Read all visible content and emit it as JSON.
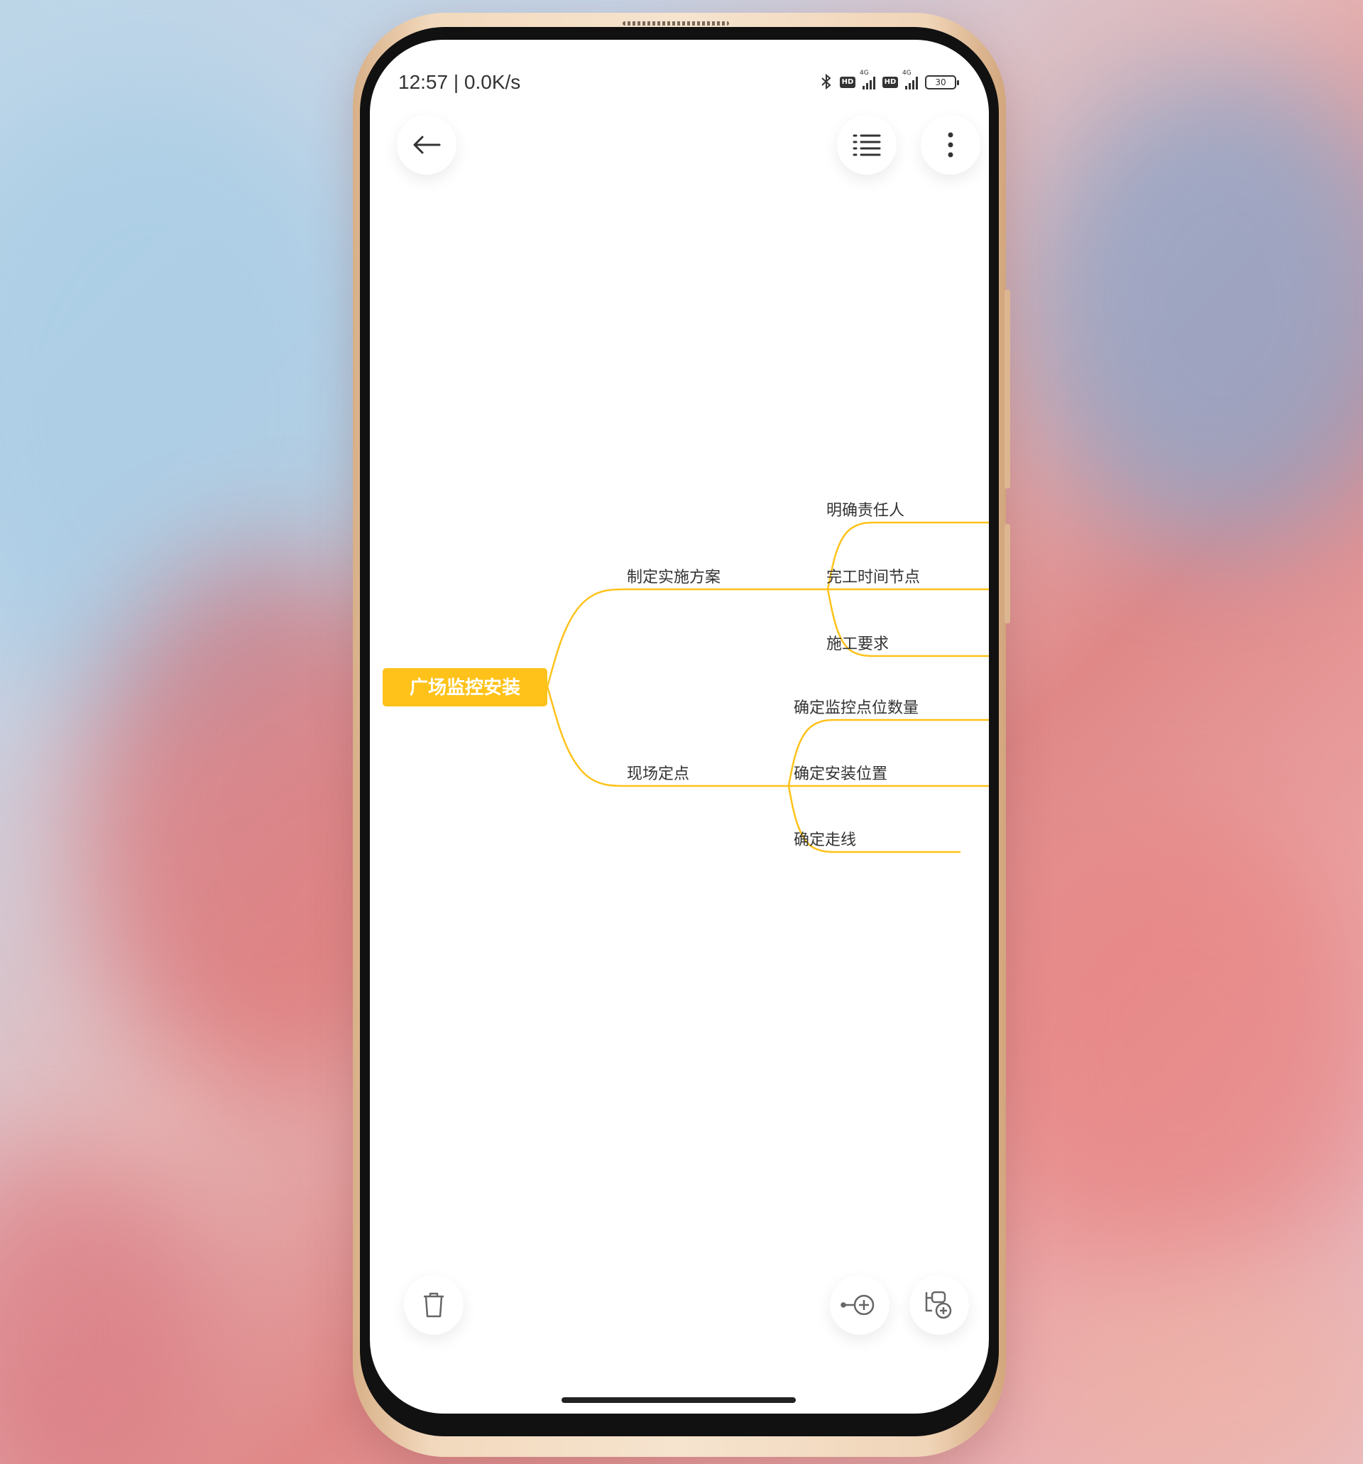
{
  "status_bar": {
    "time_speed": "12:57 | 0.0K/s",
    "bluetooth_icon": "bluetooth-icon",
    "hd_label": "HD",
    "network_label": "4G",
    "battery_level": "30"
  },
  "toolbar": {
    "back_icon": "arrow-left-icon",
    "outline_icon": "outline-list-icon",
    "more_icon": "more-vertical-icon"
  },
  "mindmap": {
    "accent_color": "#FFC21A",
    "root": "广场监控安装",
    "branches": [
      {
        "label": "制定实施方案",
        "children": [
          "明确责任人",
          "完工时间节点",
          "施工要求"
        ]
      },
      {
        "label": "现场定点",
        "children": [
          "确定监控点位数量",
          "确定安装位置",
          "确定走线"
        ]
      }
    ]
  },
  "bottom_bar": {
    "delete_icon": "trash-icon",
    "add_sibling_icon": "add-sibling-node-icon",
    "add_child_icon": "add-child-node-icon"
  }
}
